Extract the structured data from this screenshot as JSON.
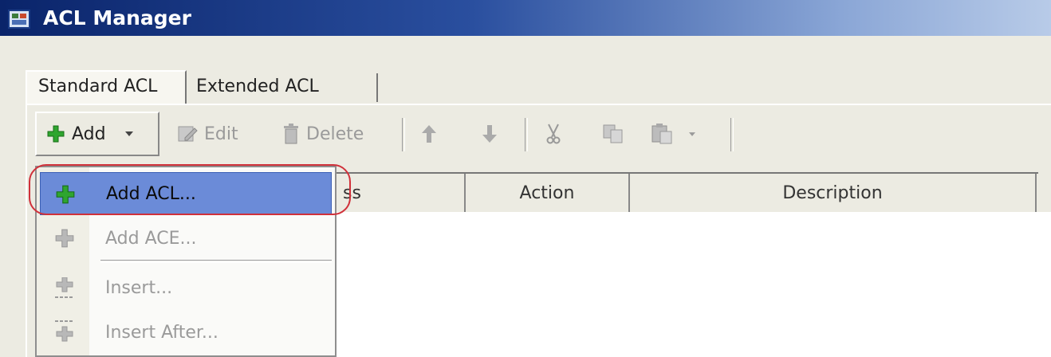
{
  "window": {
    "title": "ACL Manager"
  },
  "tabs": [
    {
      "label": "Standard ACL",
      "active": true
    },
    {
      "label": "Extended ACL",
      "active": false
    }
  ],
  "toolbar": {
    "add_label": "Add",
    "edit_label": "Edit",
    "delete_label": "Delete"
  },
  "table": {
    "columns": [
      "ss",
      "Action",
      "Description"
    ]
  },
  "add_menu": {
    "items": [
      {
        "label": "Add ACL...",
        "enabled": true,
        "highlighted": true
      },
      {
        "label": "Add ACE...",
        "enabled": false
      },
      {
        "label": "Insert...",
        "enabled": false
      },
      {
        "label": "Insert After...",
        "enabled": false
      }
    ]
  },
  "colors": {
    "titlebar_start": "#0a246a",
    "menu_highlight": "#6b8bd8",
    "add_green": "#2fa52f",
    "focus_ring": "#d0303a"
  }
}
